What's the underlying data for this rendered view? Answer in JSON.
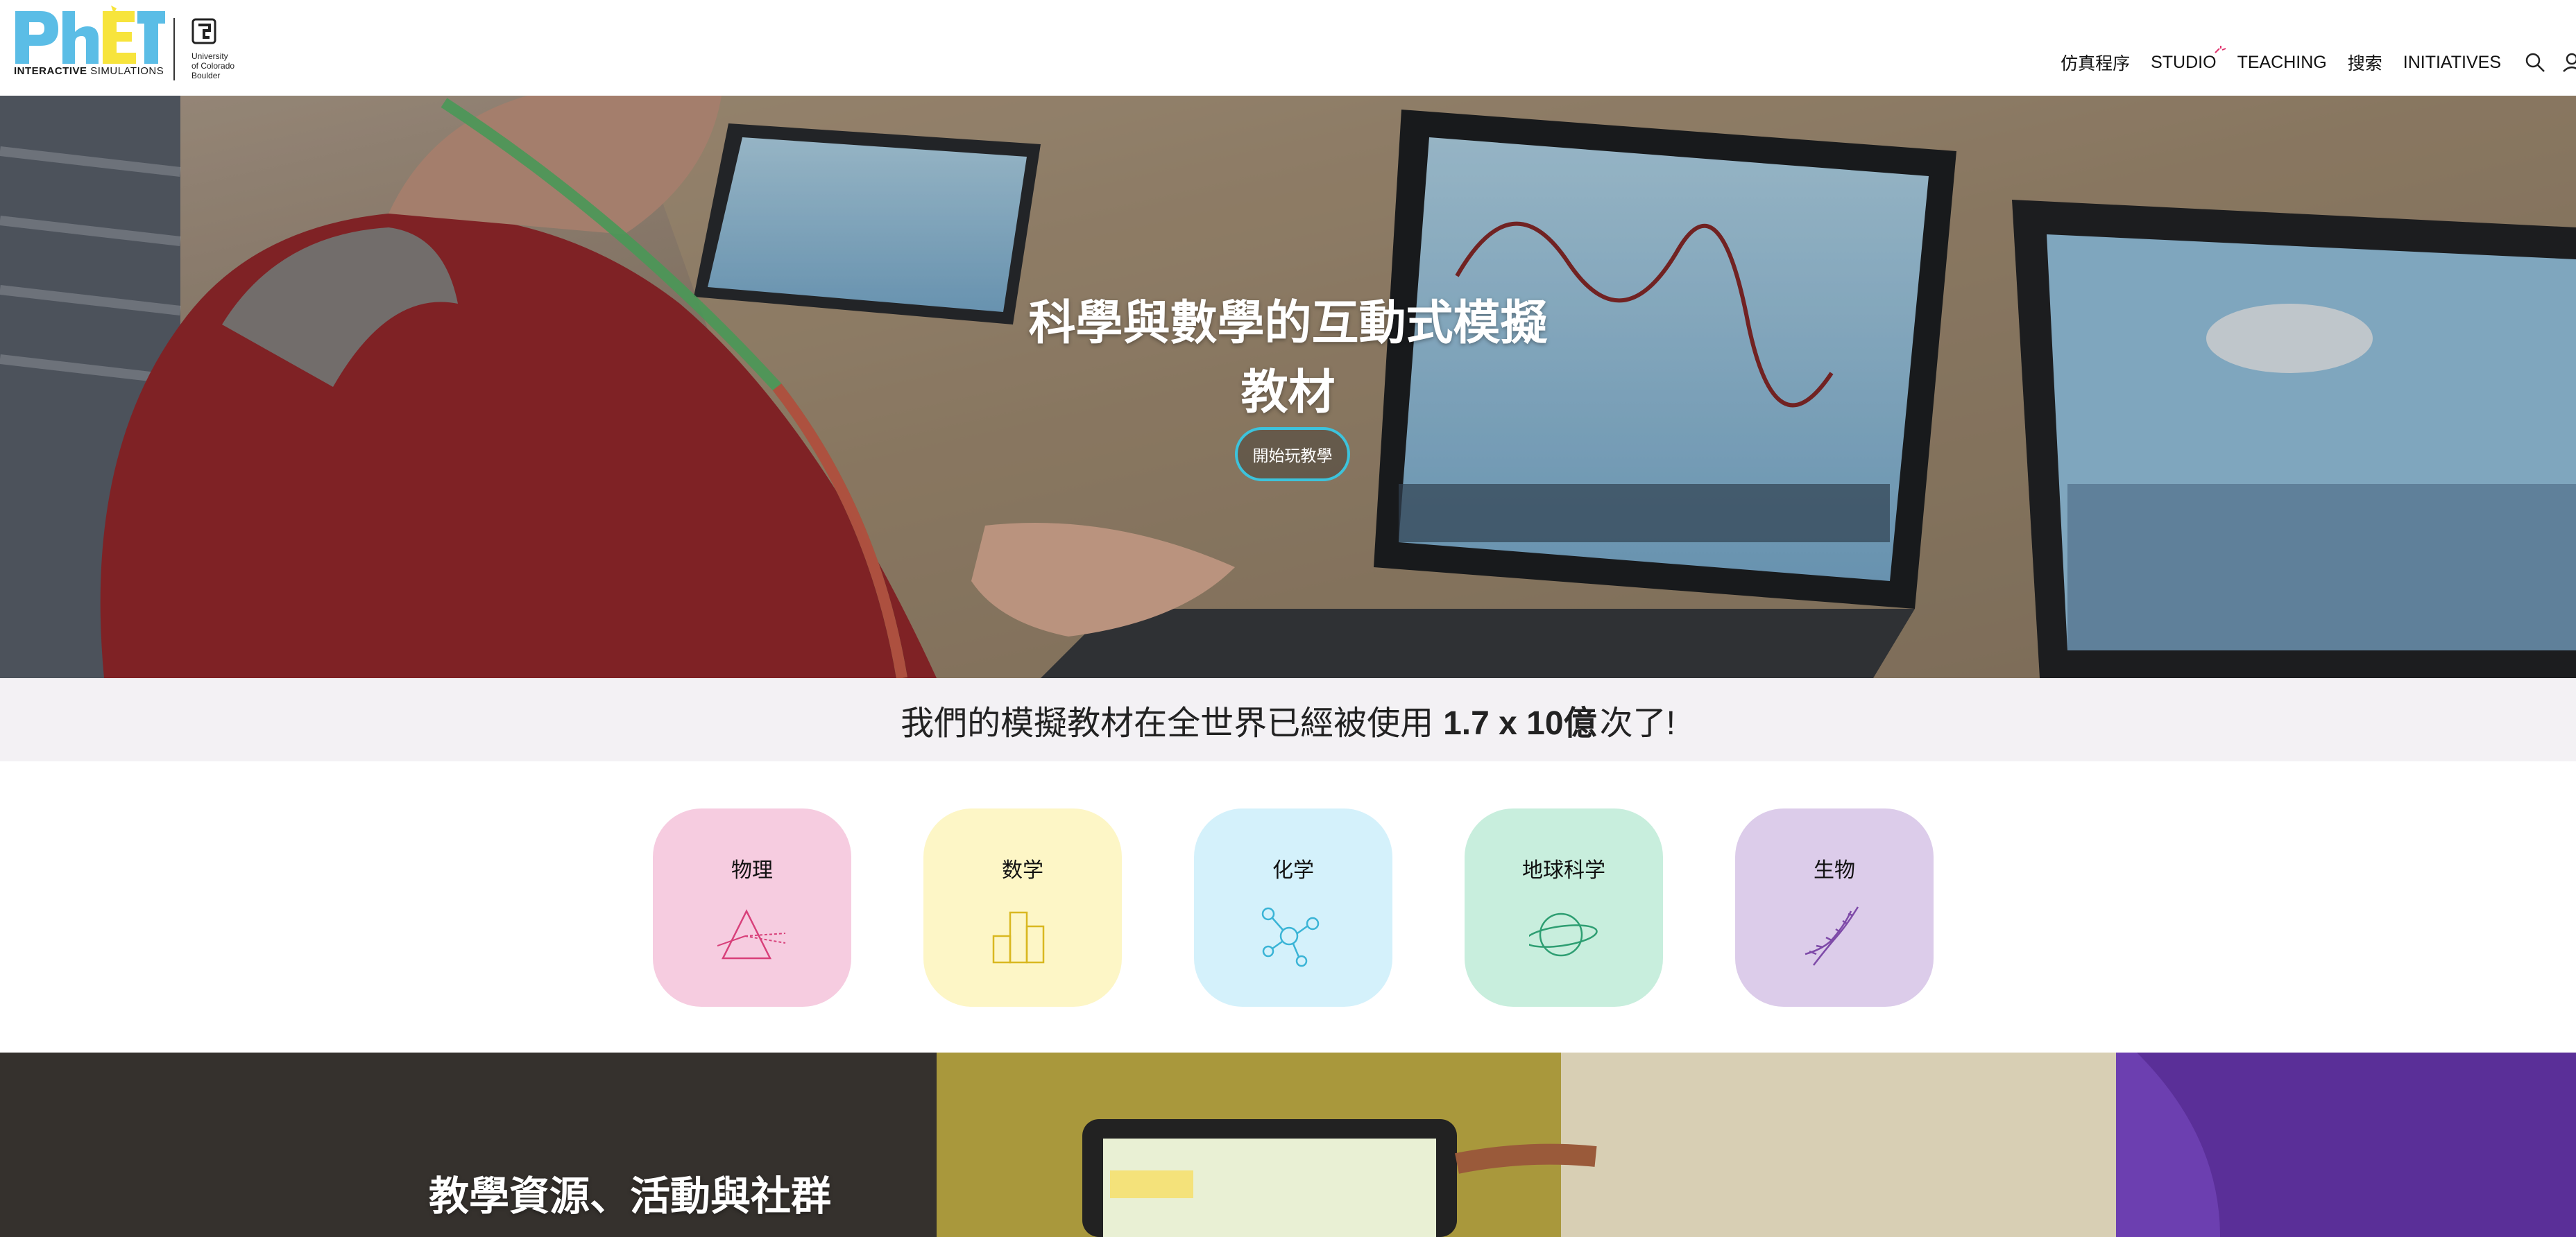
{
  "brand": {
    "logo_text": "PhET",
    "logo_subtitle_bold": "INTERACTIVE",
    "logo_subtitle": "SIMULATIONS",
    "university_line1": "University",
    "university_line2": "of Colorado",
    "university_line3": "Boulder",
    "colors": {
      "blue": "#5bbde6",
      "yellow": "#f7e43c",
      "teal_accent": "#3cc3dc"
    }
  },
  "nav": {
    "items": [
      {
        "label": "仿真程序"
      },
      {
        "label": "STUDIO"
      },
      {
        "label": "TEACHING"
      },
      {
        "label": "搜索"
      },
      {
        "label": "INITIATIVES"
      }
    ],
    "icons": [
      "search-icon",
      "user-icon"
    ]
  },
  "hero": {
    "title_line1": "科學與數學的互動式模擬",
    "title_line2": "教材",
    "button_label": "開始玩教學"
  },
  "stats": {
    "prefix": "我們的模擬教材在全世界已經被使用",
    "number": "1.7 x 10億",
    "suffix": "次了!"
  },
  "subjects": [
    {
      "label": "物理",
      "icon": "prism-icon",
      "color": "#f6cce0",
      "stroke": "#d8407a"
    },
    {
      "label": "数学",
      "icon": "bar-chart-icon",
      "color": "#fdf6c6",
      "stroke": "#d9b820"
    },
    {
      "label": "化学",
      "icon": "molecule-icon",
      "color": "#d4f1fb",
      "stroke": "#3ab4d6"
    },
    {
      "label": "地球科学",
      "icon": "planet-icon",
      "color": "#c8eedd",
      "stroke": "#2e9e72"
    },
    {
      "label": "生物",
      "icon": "dna-icon",
      "color": "#dcccea",
      "stroke": "#7e4aa8"
    }
  ],
  "bottom": {
    "title": "教學資源、活動與社群"
  }
}
